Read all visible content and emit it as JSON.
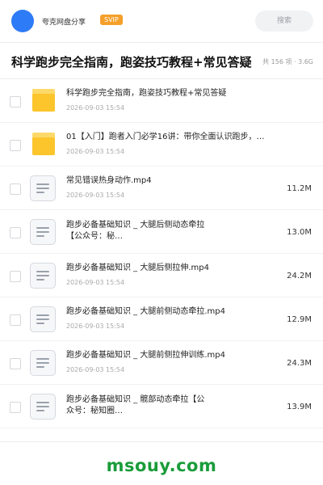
{
  "header": {
    "brand": "夸克网盘分享",
    "badge": "SVIP",
    "search_label": "搜索"
  },
  "share": {
    "title": "科学跑步完全指南，跑姿技巧教程+常见答疑",
    "summary": "共 156 项 · 3.6G"
  },
  "files": [
    {
      "type": "folder",
      "name": "科学跑步完全指南，跑姿技巧教程+常见答疑",
      "date": "2026-09-03 15:54",
      "size": ""
    },
    {
      "type": "folder",
      "name": "01【入门】跑者入门必学16讲：带你全面认识跑步，…",
      "date": "2026-09-03 15:54",
      "size": ""
    },
    {
      "type": "file",
      "name": "常见错误热身动作.mp4",
      "date": "2026-09-03 15:54",
      "size": "11.2M"
    },
    {
      "type": "file",
      "name": "跑步必备基础知识 _ 大腿后侧动态牵拉【公众号：秘…",
      "date": "",
      "size": "13.0M"
    },
    {
      "type": "file",
      "name": "跑步必备基础知识 _ 大腿后侧拉伸.mp4",
      "date": "2026-09-03 15:54",
      "size": "24.2M"
    },
    {
      "type": "file",
      "name": "跑步必备基础知识 _ 大腿前侧动态牵拉.mp4",
      "date": "2026-09-03 15:54",
      "size": "12.9M"
    },
    {
      "type": "file",
      "name": "跑步必备基础知识 _ 大腿前侧拉伸训练.mp4",
      "date": "2026-09-03 15:54",
      "size": "24.3M"
    },
    {
      "type": "file",
      "name": "跑步必备基础知识 _ 髋部动态牵拉【公众号：秘知圈…",
      "date": "2026-09-03 15:54",
      "size": "13.9M"
    }
  ],
  "watermark": "msouy.com"
}
